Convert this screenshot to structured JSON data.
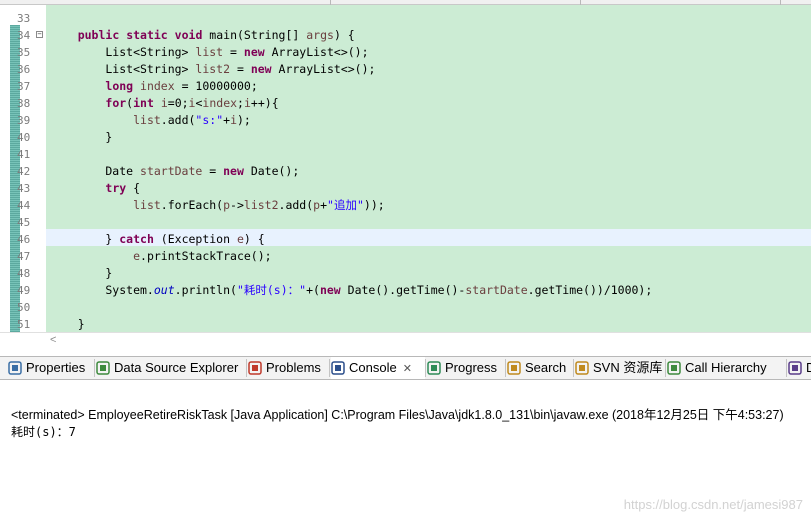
{
  "editor": {
    "lines": [
      {
        "num": "33",
        "segs": [
          {
            "t": "    ",
            "c": ""
          }
        ]
      },
      {
        "num": "34",
        "fold": true,
        "segs": [
          {
            "t": "    ",
            "c": ""
          },
          {
            "t": "public",
            "c": "kw"
          },
          {
            "t": " ",
            "c": ""
          },
          {
            "t": "static",
            "c": "kw"
          },
          {
            "t": " ",
            "c": ""
          },
          {
            "t": "void",
            "c": "kw"
          },
          {
            "t": " main(String[] ",
            "c": ""
          },
          {
            "t": "args",
            "c": "var"
          },
          {
            "t": ") {",
            "c": ""
          }
        ]
      },
      {
        "num": "35",
        "segs": [
          {
            "t": "        List<String> ",
            "c": ""
          },
          {
            "t": "list",
            "c": "var"
          },
          {
            "t": " = ",
            "c": ""
          },
          {
            "t": "new",
            "c": "kw"
          },
          {
            "t": " ArrayList<>();",
            "c": ""
          }
        ]
      },
      {
        "num": "36",
        "segs": [
          {
            "t": "        List<String> ",
            "c": ""
          },
          {
            "t": "list2",
            "c": "var"
          },
          {
            "t": " = ",
            "c": ""
          },
          {
            "t": "new",
            "c": "kw"
          },
          {
            "t": " ArrayList<>();",
            "c": ""
          }
        ]
      },
      {
        "num": "37",
        "segs": [
          {
            "t": "        ",
            "c": ""
          },
          {
            "t": "long",
            "c": "kw"
          },
          {
            "t": " ",
            "c": ""
          },
          {
            "t": "index",
            "c": "var"
          },
          {
            "t": " = 10000000;",
            "c": ""
          }
        ]
      },
      {
        "num": "38",
        "segs": [
          {
            "t": "        ",
            "c": ""
          },
          {
            "t": "for",
            "c": "kw"
          },
          {
            "t": "(",
            "c": ""
          },
          {
            "t": "int",
            "c": "kw"
          },
          {
            "t": " ",
            "c": ""
          },
          {
            "t": "i",
            "c": "var"
          },
          {
            "t": "=0;",
            "c": ""
          },
          {
            "t": "i",
            "c": "var"
          },
          {
            "t": "<",
            "c": ""
          },
          {
            "t": "index",
            "c": "var"
          },
          {
            "t": ";",
            "c": ""
          },
          {
            "t": "i",
            "c": "var"
          },
          {
            "t": "++){",
            "c": ""
          }
        ]
      },
      {
        "num": "39",
        "segs": [
          {
            "t": "            ",
            "c": ""
          },
          {
            "t": "list",
            "c": "var"
          },
          {
            "t": ".add(",
            "c": ""
          },
          {
            "t": "\"s:\"",
            "c": "str"
          },
          {
            "t": "+",
            "c": ""
          },
          {
            "t": "i",
            "c": "var"
          },
          {
            "t": ");",
            "c": ""
          }
        ]
      },
      {
        "num": "40",
        "segs": [
          {
            "t": "        }",
            "c": ""
          }
        ]
      },
      {
        "num": "41",
        "segs": [
          {
            "t": "",
            "c": ""
          }
        ]
      },
      {
        "num": "42",
        "segs": [
          {
            "t": "        Date ",
            "c": ""
          },
          {
            "t": "startDate",
            "c": "var"
          },
          {
            "t": " = ",
            "c": ""
          },
          {
            "t": "new",
            "c": "kw"
          },
          {
            "t": " Date();",
            "c": ""
          }
        ]
      },
      {
        "num": "43",
        "segs": [
          {
            "t": "        ",
            "c": ""
          },
          {
            "t": "try",
            "c": "kw"
          },
          {
            "t": " {",
            "c": ""
          }
        ]
      },
      {
        "num": "44",
        "segs": [
          {
            "t": "            ",
            "c": ""
          },
          {
            "t": "list",
            "c": "var"
          },
          {
            "t": ".forEach(",
            "c": ""
          },
          {
            "t": "p",
            "c": "var"
          },
          {
            "t": "->",
            "c": ""
          },
          {
            "t": "list2",
            "c": "var"
          },
          {
            "t": ".add(",
            "c": ""
          },
          {
            "t": "p",
            "c": "var"
          },
          {
            "t": "+",
            "c": ""
          },
          {
            "t": "\"追加\"",
            "c": "str"
          },
          {
            "t": "));",
            "c": ""
          }
        ]
      },
      {
        "num": "45",
        "segs": [
          {
            "t": "",
            "c": ""
          }
        ]
      },
      {
        "num": "46",
        "segs": [
          {
            "t": "        } ",
            "c": ""
          },
          {
            "t": "catch",
            "c": "kw"
          },
          {
            "t": " (Exception ",
            "c": ""
          },
          {
            "t": "e",
            "c": "var"
          },
          {
            "t": ") {",
            "c": ""
          }
        ]
      },
      {
        "num": "47",
        "segs": [
          {
            "t": "            ",
            "c": ""
          },
          {
            "t": "e",
            "c": "var"
          },
          {
            "t": ".printStackTrace();",
            "c": ""
          }
        ]
      },
      {
        "num": "48",
        "segs": [
          {
            "t": "        }",
            "c": ""
          }
        ]
      },
      {
        "num": "49",
        "segs": [
          {
            "t": "        System.",
            "c": ""
          },
          {
            "t": "out",
            "c": "fld"
          },
          {
            "t": ".println(",
            "c": ""
          },
          {
            "t": "\"耗时(s)：\"",
            "c": "str"
          },
          {
            "t": "+(",
            "c": ""
          },
          {
            "t": "new",
            "c": "kw"
          },
          {
            "t": " Date().getTime()-",
            "c": ""
          },
          {
            "t": "startDate",
            "c": "var"
          },
          {
            "t": ".getTime())/1000);",
            "c": ""
          }
        ]
      },
      {
        "num": "50",
        "segs": [
          {
            "t": "",
            "c": ""
          }
        ]
      },
      {
        "num": "51",
        "segs": [
          {
            "t": "    }",
            "c": ""
          }
        ]
      }
    ]
  },
  "scroll": {
    "left_arrow": "<"
  },
  "tabs": [
    {
      "label": "Properties",
      "icon": "properties-icon",
      "color": "#3a6ea5"
    },
    {
      "label": "Data Source Explorer",
      "icon": "database-icon",
      "color": "#3d8a3d"
    },
    {
      "label": "Problems",
      "icon": "problems-icon",
      "color": "#c0392b"
    },
    {
      "label": "Console",
      "icon": "console-icon",
      "color": "#2c4f8c",
      "active": true,
      "close": "✕"
    },
    {
      "label": "Progress",
      "icon": "progress-icon",
      "color": "#2e8b57"
    },
    {
      "label": "Search",
      "icon": "search-icon",
      "color": "#c08a1e"
    },
    {
      "label": "SVN 资源库",
      "icon": "svn-icon",
      "color": "#c08a1e"
    },
    {
      "label": "Call Hierarchy",
      "icon": "call-hierarchy-icon",
      "color": "#3d8a3d"
    },
    {
      "label": "De",
      "icon": "debug-icon",
      "color": "#5a3d8a"
    }
  ],
  "console": {
    "terminated": "<terminated> EmployeeRetireRiskTask [Java Application] C:\\Program Files\\Java\\jdk1.8.0_131\\bin\\javaw.exe (2018年12月25日 下午4:53:27)",
    "output": "耗时(s)：7"
  },
  "watermark": "https://blog.csdn.net/jamesi987"
}
